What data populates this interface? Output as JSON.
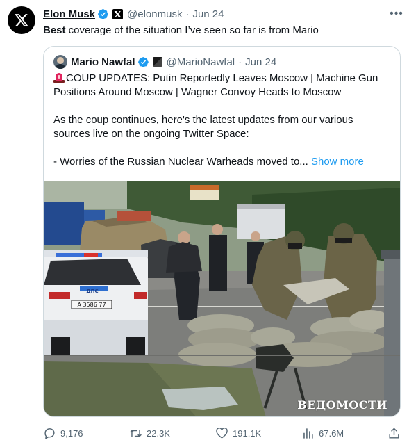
{
  "author": {
    "name": "Elon Musk",
    "handle": "@elonmusk",
    "date": "Jun 24"
  },
  "tweet": {
    "bold_lead": "Best",
    "text_rest": " coverage of the situation I’ve seen so far is from Mario"
  },
  "quote": {
    "name": "Mario Nawfal",
    "handle": "@MarioNawfal",
    "date": "Jun 24",
    "line1": "COUP UPDATES: Putin Reportedly Leaves Moscow | Machine Gun Positions Around Moscow | Wagner Convoy Heads to Moscow",
    "line2": "As the coup continues, here's the latest updates from our various sources live on the ongoing Twitter Space:",
    "line3": "- Worries of the Russian Nuclear Warheads moved to...",
    "show_more": "Show more",
    "media": {
      "watermark": "ВЕДОМОСТИ",
      "plate": "А 3586 77",
      "car_text": "ДПС"
    }
  },
  "actions": {
    "replies": "9,176",
    "reposts": "22.3K",
    "likes": "191.1K",
    "views": "67.6M"
  },
  "colors": {
    "accent": "#1d9bf0",
    "muted": "#536471",
    "border": "#cfd9de",
    "verified": "#1d9bf0"
  },
  "icons": [
    "x-logo-icon",
    "verified-badge-icon",
    "affiliate-badge-icon",
    "more-icon",
    "siren-icon",
    "reply-icon",
    "repost-icon",
    "like-icon",
    "views-icon",
    "share-icon"
  ]
}
